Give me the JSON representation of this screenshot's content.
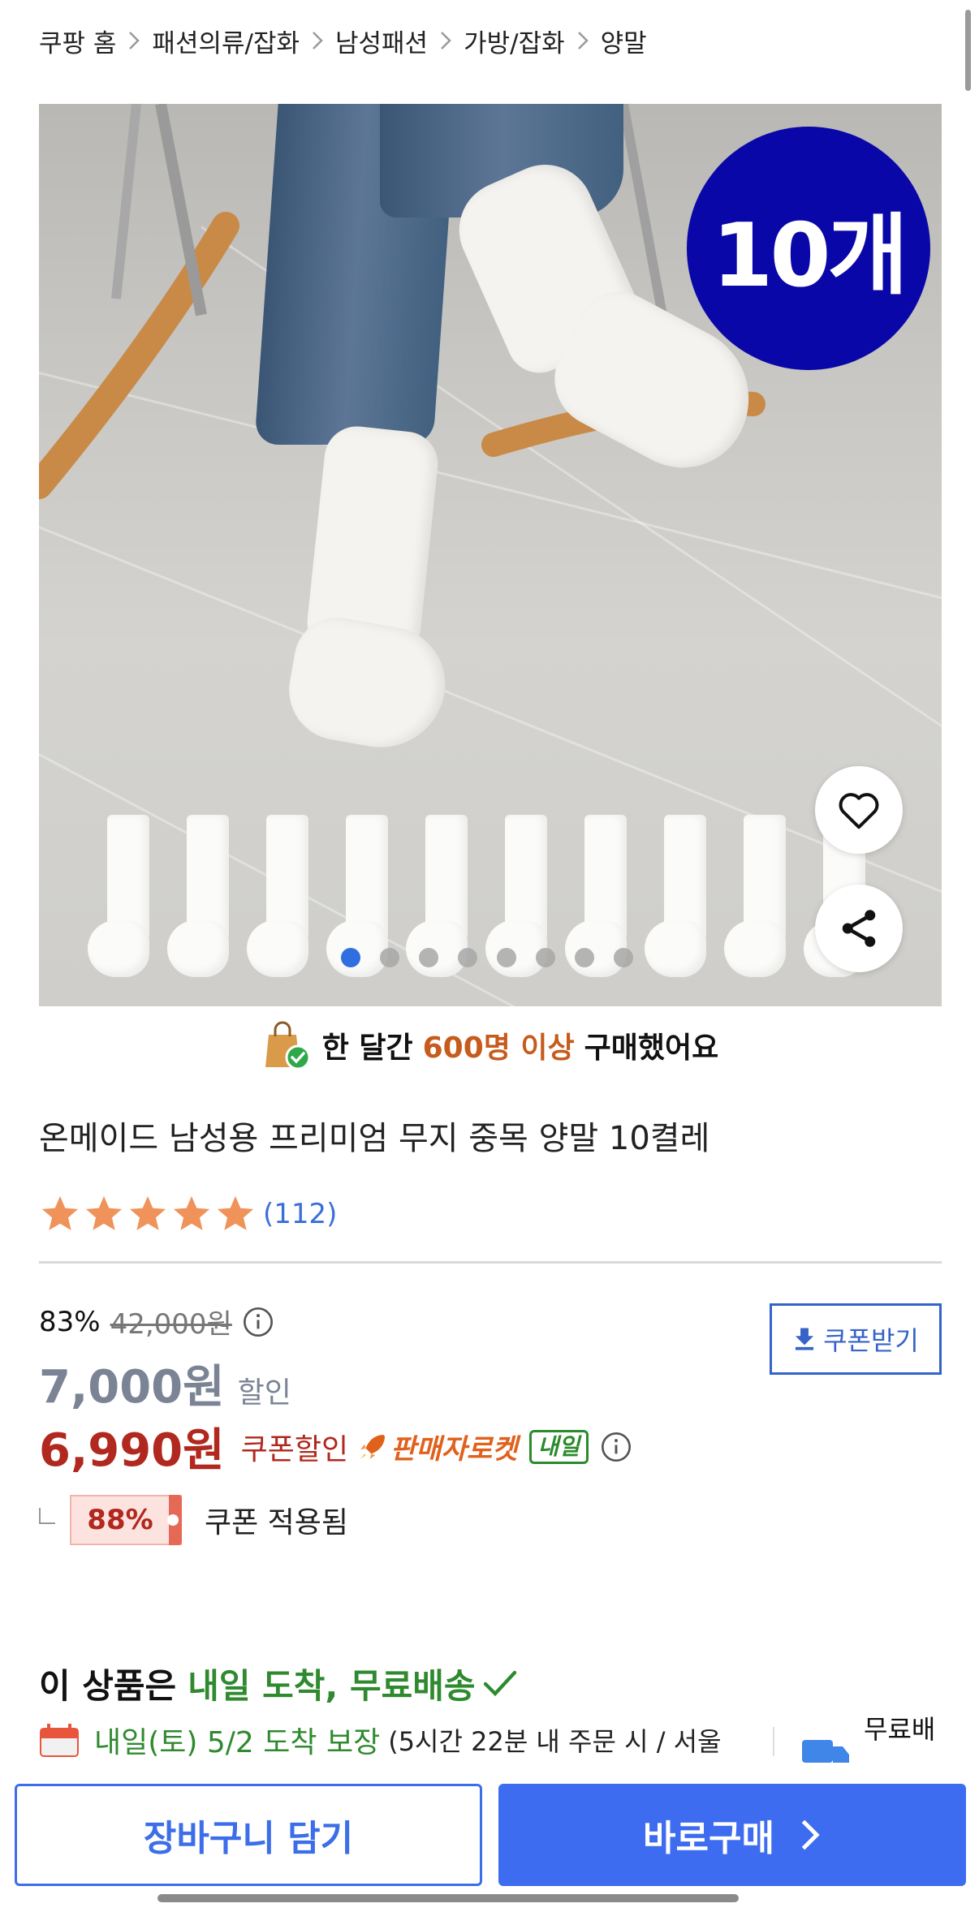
{
  "breadcrumb": [
    "쿠팡 홈",
    "패션의류/잡화",
    "남성패션",
    "가방/잡화",
    "양말"
  ],
  "image": {
    "badge": "10개",
    "dots_total": 8,
    "dots_active": 1
  },
  "purchase_banner": {
    "prefix": "한 달간",
    "highlight": "600명 이상",
    "suffix": "구매했어요"
  },
  "product": {
    "title": "온메이드 남성용 프리미엄 무지 중목 양말 10켤레",
    "rating": 5,
    "review_count": "(112)"
  },
  "price": {
    "discount_rate": "83%",
    "original": "42,000원",
    "sale": "7,000원",
    "sale_label": "할인",
    "coupon_price": "6,990원",
    "coupon_label": "쿠폰할인",
    "seller_rocket": "판매자로켓",
    "tomorrow_tag": "내일",
    "coupon_button": "쿠폰받기"
  },
  "coupon_applied": {
    "rate": "88%",
    "text": "쿠폰 적용됨"
  },
  "delivery": {
    "headline_prefix": "이 상품은",
    "headline_highlight": "내일 도착, 무료배송",
    "date": "내일(토) 5/2 도착 보장",
    "note": "(5시간 22분 내 주문 시 / 서울",
    "free_shipping": "무료배"
  },
  "actions": {
    "cart": "장바구니 담기",
    "buy": "바로구매"
  },
  "colors": {
    "accent_blue": "#3e6cf0",
    "price_red": "#b0281e",
    "delivery_green": "#2f8a2f",
    "badge_blue": "#0a07a8"
  }
}
